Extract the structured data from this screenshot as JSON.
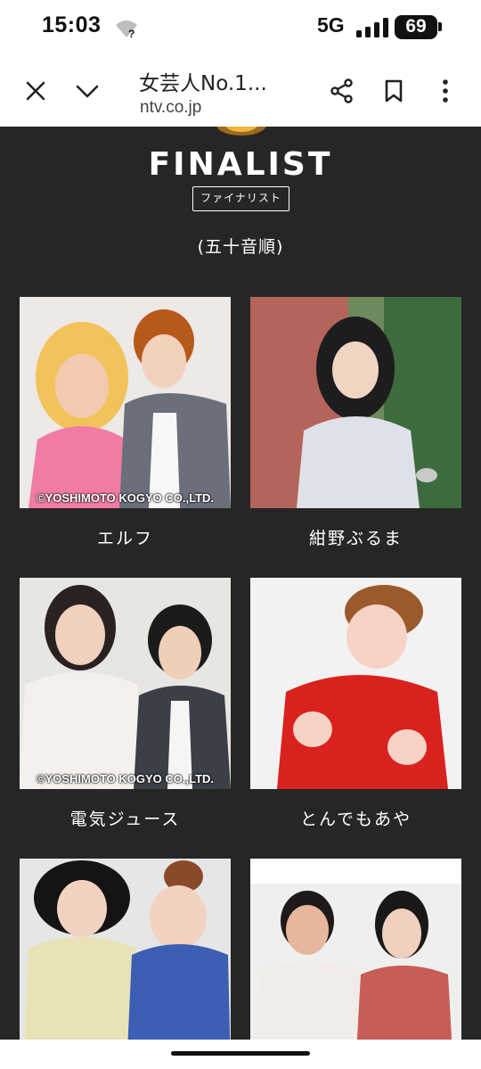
{
  "status_bar": {
    "time": "15:03",
    "network": "5G",
    "battery": "69",
    "wifi_badge": "?"
  },
  "browser": {
    "title": "女芸人No.1...",
    "url": "ntv.co.jp"
  },
  "page": {
    "heading": "FINALIST",
    "subheading": "ファイナリスト",
    "order_note": "(五十音順)",
    "finalists": [
      {
        "name": "エルフ",
        "credit": "©YOSHIMOTO KOGYO CO.,LTD."
      },
      {
        "name": "紺野ぶるま",
        "credit": ""
      },
      {
        "name": "電気ジュース",
        "credit": "©YOSHIMOTO KOGYO CO.,LTD."
      },
      {
        "name": "とんでもあや",
        "credit": ""
      },
      {
        "name": "",
        "credit": ""
      },
      {
        "name": "",
        "credit": ""
      }
    ]
  },
  "colors": {
    "background": "#262626",
    "text": "#ffffff"
  }
}
